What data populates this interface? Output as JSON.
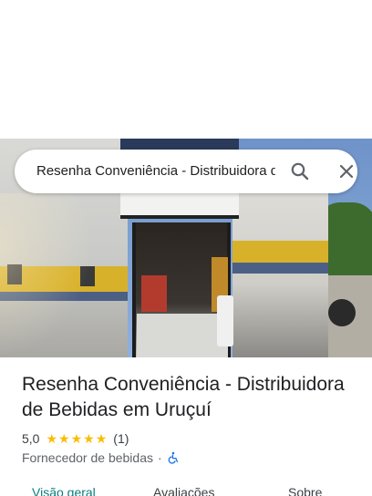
{
  "search": {
    "query": "Resenha Conveniência - Distribuidora de Bebidas em Uruçuí"
  },
  "place": {
    "title": "Resenha Conveniência - Distribuidora de Bebidas em Uruçuí",
    "rating": "5,0",
    "stars": 5,
    "review_count": "(1)",
    "category": "Fornecedor de bebidas",
    "separator": "·"
  },
  "tabs": [
    {
      "label": "Visão geral",
      "active": true
    },
    {
      "label": "Avaliações",
      "active": false
    },
    {
      "label": "Sobre",
      "active": false
    }
  ],
  "icons": {
    "search": "search-icon",
    "close": "close-icon",
    "accessibility": "wheelchair-icon",
    "star": "star-icon"
  },
  "colors": {
    "accent": "#0b7d80",
    "star": "#fbbc04",
    "accessibility": "#1a73e8"
  }
}
